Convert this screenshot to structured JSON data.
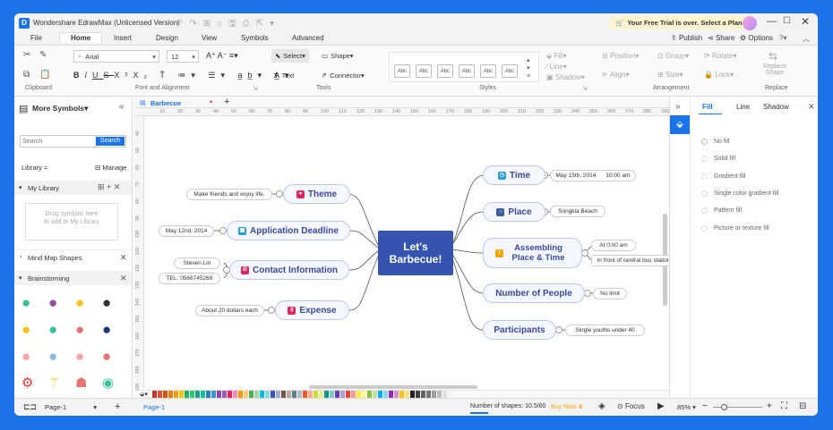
{
  "app": {
    "title": "Wondershare EdrawMax (Unlicensed Version)",
    "trial_banner": "Your Free Trial is over. Select a Plan"
  },
  "menu": {
    "tabs": [
      "File",
      "Home",
      "Insert",
      "Design",
      "View",
      "Symbols",
      "Advanced"
    ],
    "active": "Home",
    "publish": "Publish",
    "share": "Share",
    "options": "Options"
  },
  "ribbon": {
    "font_name": "Arial",
    "font_size": "12",
    "select": "Select",
    "shape": "Shape",
    "text": "Text",
    "connector": "Connector",
    "fill": "Fill",
    "line": "Line",
    "shadow": "Shadow",
    "style_sample": "Abc",
    "position": "Position",
    "group": "Group",
    "rotate": "Rotate",
    "align": "Align",
    "size": "Size",
    "lock": "Lock",
    "replace_shape": "Replace Shape",
    "groups": {
      "clipboard": "Clipboard",
      "font": "Font and Alignment",
      "tools": "Tools",
      "styles": "Styles",
      "arrangement": "Arrangement",
      "replace": "Replace"
    }
  },
  "left_panel": {
    "title": "More Symbols",
    "search_placeholder": "Search",
    "search_button": "Search",
    "library": "Library",
    "manage": "Manage",
    "my_library": "My Library",
    "drag_hint": "Drag symbols here to add to My Library",
    "mind_map_shapes": "Mind Map Shapes",
    "brainstorming": "Brainstorming"
  },
  "document": {
    "tab": "Barbecue",
    "page": "Page-1",
    "page_tab": "Page-1"
  },
  "ruler": {
    "h": [
      "10",
      "20",
      "30",
      "40",
      "50",
      "60",
      "70",
      "80",
      "90",
      "100",
      "110",
      "120",
      "130",
      "140",
      "150",
      "160",
      "170",
      "180",
      "190",
      "200",
      "210",
      "220",
      "230",
      "240",
      "250",
      "260",
      "270",
      "280",
      "290"
    ],
    "v": [
      "40",
      "50",
      "60",
      "70",
      "80",
      "90",
      "100",
      "110",
      "120",
      "130",
      "140",
      "150",
      "160",
      "170",
      "180",
      "190"
    ]
  },
  "mindmap": {
    "center": "Let's Barbecue!",
    "right": [
      {
        "label": "Time",
        "icon": "clock-icon",
        "color": "#2a9bd6",
        "details": [
          "May 15th, 2014",
          "10:00 am"
        ]
      },
      {
        "label": "Place",
        "icon": "house-icon",
        "color": "#3b5b9c",
        "details": [
          "Songkla Beach"
        ]
      },
      {
        "label": "Assembling Place & Time",
        "icon": "alert-icon",
        "color": "#f0a500",
        "details": [
          "At 0:00 am",
          "In front of central bus station"
        ]
      },
      {
        "label": "Number of People",
        "icon": "",
        "color": "",
        "details": [
          "No limit"
        ]
      },
      {
        "label": "Participants",
        "icon": "",
        "color": "",
        "details": [
          "Single youths under 40"
        ]
      }
    ],
    "left": [
      {
        "label": "Theme",
        "icon": "heart-icon",
        "color": "#e0245e",
        "details": [
          "Make friends and enjoy life."
        ]
      },
      {
        "label": "Application Deadline",
        "icon": "calendar-icon",
        "color": "#2a9bd6",
        "details": [
          "May 12nd, 2014"
        ]
      },
      {
        "label": "Contact Information",
        "icon": "phone-icon",
        "color": "#e0245e",
        "details": [
          "Steven Lin",
          "TEL: 0568745269"
        ]
      },
      {
        "label": "Expense",
        "icon": "money-icon",
        "color": "#e0245e",
        "details": [
          "About 20 dollars each"
        ]
      }
    ]
  },
  "right_panel": {
    "tabs": [
      "Fill",
      "Line",
      "Shadow"
    ],
    "active": "Fill",
    "options": [
      "No fill",
      "Solid fill",
      "Gradient fill",
      "Single color gradient fill",
      "Pattern fill",
      "Picture or texture fill"
    ]
  },
  "status": {
    "shapes": "Number of shapes: 10.5/60",
    "buy": "Buy Now",
    "focus": "Focus",
    "zoom": "85%"
  },
  "palette": [
    "#c0392b",
    "#e74c3c",
    "#d35400",
    "#e67e22",
    "#f39c12",
    "#f1c40f",
    "#27ae60",
    "#2ecc71",
    "#16a085",
    "#1abc9c",
    "#2980b9",
    "#3498db",
    "#8e44ad",
    "#9b59b6",
    "#e91e63",
    "#f48fb1",
    "#ff9800",
    "#ffcc80",
    "#4caf50",
    "#a5d6a7",
    "#00bcd4",
    "#80deea",
    "#3f51b5",
    "#9fa8da",
    "#795548",
    "#bcaaa4",
    "#607d8b",
    "#b0bec5",
    "#ff5722",
    "#ffab91",
    "#cddc39",
    "#e6ee9c",
    "#009688",
    "#80cbc4",
    "#673ab7",
    "#b39ddb",
    "#f44336",
    "#ef9a9a",
    "#ffeb3b",
    "#fff59d",
    "#8bc34a",
    "#c5e1a5",
    "#03a9f4",
    "#81d4fa",
    "#9c27b0",
    "#ce93d8",
    "#ffc107",
    "#ffe082",
    "#212121",
    "#424242",
    "#616161",
    "#757575",
    "#9e9e9e",
    "#bdbdbd",
    "#e0e0e0",
    "#f5f5f5"
  ]
}
